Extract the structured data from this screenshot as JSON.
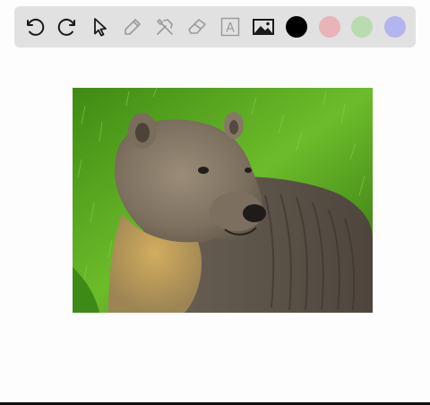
{
  "toolbar": {
    "tools": [
      {
        "name": "undo-icon",
        "enabled": true
      },
      {
        "name": "redo-icon",
        "enabled": true
      },
      {
        "name": "pointer-icon",
        "enabled": true
      },
      {
        "name": "pencil-icon",
        "enabled": false
      },
      {
        "name": "tools-icon",
        "enabled": false
      },
      {
        "name": "eraser-icon",
        "enabled": false
      },
      {
        "name": "text-icon",
        "enabled": false,
        "glyph": "A"
      },
      {
        "name": "image-icon",
        "enabled": true
      }
    ],
    "colors": [
      "#000000",
      "#e8b4b8",
      "#b8dcb0",
      "#b4b4f0"
    ]
  },
  "canvas": {
    "image": {
      "subject": "bear-photo",
      "colors": {
        "grass": "#4e9a1e",
        "fur": "#8b7d6b",
        "throat": "#c9a55a"
      }
    }
  }
}
